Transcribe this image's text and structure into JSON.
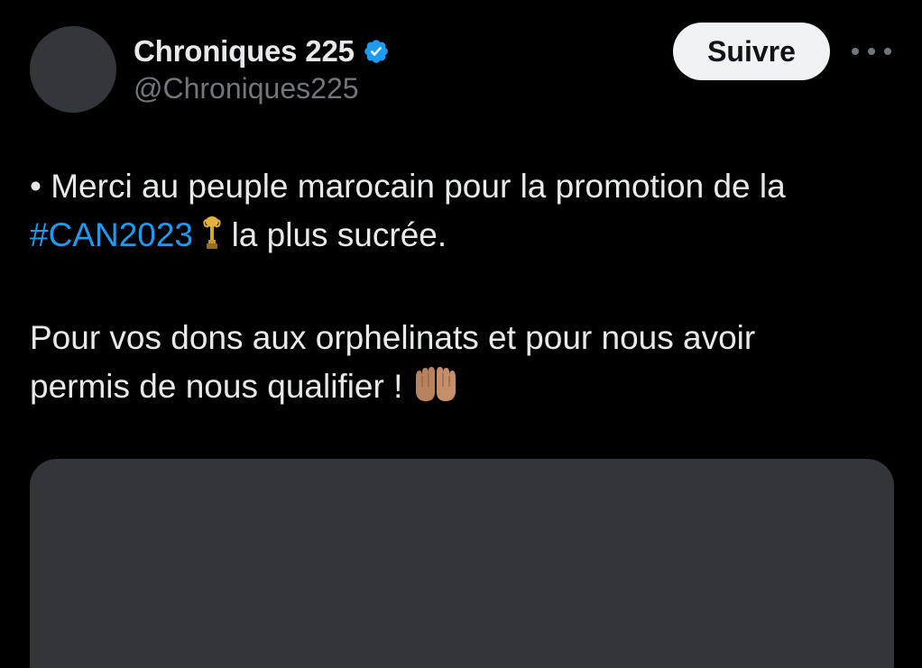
{
  "author": {
    "display_name": "Chroniques 225",
    "handle": "@Chroniques225",
    "verified": true
  },
  "actions": {
    "follow_label": "Suivre",
    "more_icon": "more-horizontal-icon"
  },
  "tweet": {
    "line1": "• Merci au peuple marocain pour la promotion de la",
    "hashtag": "#CAN2023",
    "trophy_icon": "trophy-icon",
    "line2_rest": "la plus sucrée.",
    "para2_line1": "Pour vos dons aux orphelinats et pour nous avoir",
    "para2_line2": "permis de nous qualifier !",
    "hands_icon": "palms-up-together-icon"
  },
  "colors": {
    "background": "#000000",
    "text": "#e7e9ea",
    "secondary_text": "#71767b",
    "link": "#1d9bf0",
    "verified_badge": "#1d9bf0",
    "follow_button_bg": "#eff3f4",
    "placeholder": "#33363a"
  }
}
